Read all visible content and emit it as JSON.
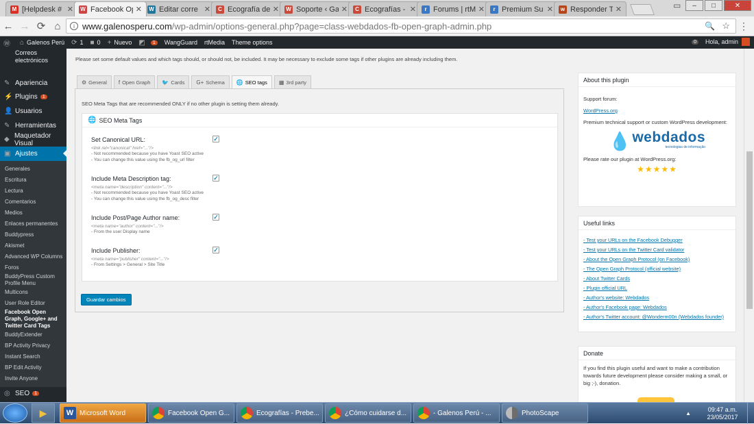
{
  "browser": {
    "tabs": [
      {
        "title": "[Helpdesk #",
        "color": "#d93025",
        "glyph": "M"
      },
      {
        "title": "Facebook Op",
        "color": "#cc4444",
        "glyph": "W",
        "active": true
      },
      {
        "title": "Editar corre",
        "color": "#21759b",
        "glyph": "W"
      },
      {
        "title": "Ecografía de",
        "color": "#c94a3a",
        "glyph": "C"
      },
      {
        "title": "Soporte ‹ Ga",
        "color": "#c94a3a",
        "glyph": "W"
      },
      {
        "title": "Ecografías -",
        "color": "#c94a3a",
        "glyph": "C"
      },
      {
        "title": "Forums | rtM",
        "color": "#3a78c4",
        "glyph": "r"
      },
      {
        "title": "Premium Su",
        "color": "#3a78c4",
        "glyph": "r"
      },
      {
        "title": "Responder T",
        "color": "#b5451b",
        "glyph": "w"
      }
    ],
    "url_host": "www.galenosperu.com",
    "url_path": "/wp-admin/options-general.php?page=class-webdados-fb-open-graph-admin.php"
  },
  "adminbar": {
    "site": "Galenos Perú",
    "updates": "1",
    "comments": "0",
    "new": "Nuevo",
    "plugin_count": "1",
    "wangguard": "WangGuard",
    "rtmedia": "rtMedia",
    "theme_options": "Theme options",
    "notif": "0",
    "greeting": "Hola, admin"
  },
  "sidebar": {
    "top_item": "Correos electrónicos",
    "items": [
      {
        "label": "Apariencia",
        "icon": "paintbrush-icon",
        "glyph": "✎"
      },
      {
        "label": "Plugins",
        "icon": "plug-icon",
        "glyph": "⚡",
        "badge": "1"
      },
      {
        "label": "Usuarios",
        "icon": "users-icon",
        "glyph": "👤"
      },
      {
        "label": "Herramientas",
        "icon": "wrench-icon",
        "glyph": "✎"
      },
      {
        "label": "Maquetador Visual",
        "icon": "builder-icon",
        "glyph": "◆"
      },
      {
        "label": "Ajustes",
        "icon": "settings-icon",
        "glyph": "▣",
        "current": true
      }
    ],
    "sub_items": [
      {
        "label": "Generales"
      },
      {
        "label": "Escritura"
      },
      {
        "label": "Lectura"
      },
      {
        "label": "Comentarios"
      },
      {
        "label": "Medios"
      },
      {
        "label": "Enlaces permanentes"
      },
      {
        "label": "Buddypress"
      },
      {
        "label": "Akismet"
      },
      {
        "label": "Advanced WP Columns"
      },
      {
        "label": "Foros"
      },
      {
        "label": "BuddyPress Custom Profile Menu"
      },
      {
        "label": "Multicons"
      },
      {
        "label": "User Role Editor"
      },
      {
        "label": "Facebook Open Graph, Google+ and Twitter Card Tags",
        "current": true
      },
      {
        "label": "BuddyExtender"
      },
      {
        "label": "BP Activity Privacy"
      },
      {
        "label": "Instant Search"
      },
      {
        "label": "BP Edit Activity"
      },
      {
        "label": "Invite Anyone"
      }
    ],
    "bottom_item": "SEO",
    "bottom_badge": "1"
  },
  "main": {
    "intro": "Please set some default values and which tags should, or should not, be included. It may be necessary to exclude some tags if other plugins are already including them.",
    "tabs": [
      {
        "label": "General",
        "glyph": "⚙"
      },
      {
        "label": "Open Graph",
        "glyph": "f"
      },
      {
        "label": "Cards",
        "glyph": "🐦"
      },
      {
        "label": "Schema",
        "glyph": "G+"
      },
      {
        "label": "SEO tags",
        "glyph": "🌐",
        "active": true
      },
      {
        "label": "3rd party",
        "glyph": "▦"
      }
    ],
    "lead": "SEO Meta Tags that are recommended ONLY if no other plugin is setting them already.",
    "panel_title": "SEO Meta Tags",
    "options": [
      {
        "label": "Set Canonical URL:",
        "code": "<link rel=\"canonical\" href=\"...\"/>",
        "notes": [
          "- Not recommended because you have Yoast SEO active",
          "- You can change this value using the fb_og_url filter"
        ],
        "checked": true
      },
      {
        "label": "Include Meta Description tag:",
        "code": "<meta name=\"description\" content=\"...\"/>",
        "notes": [
          "- Not recommended because you have Yoast SEO active",
          "- You can change this value using the fb_og_desc filter"
        ],
        "checked": true
      },
      {
        "label": "Include Post/Page Author name:",
        "code": "<meta name=\"author\" content=\"...\"/>",
        "notes": [
          "- From the user Display name"
        ],
        "checked": true
      },
      {
        "label": "Include Publisher:",
        "code": "<meta name=\"publisher\" content=\"...\"/>",
        "notes": [
          "- From Settings > General > Site Title"
        ],
        "checked": true
      }
    ],
    "save_label": "Guardar cambios"
  },
  "about": {
    "title": "About this plugin",
    "support_label": "Support forum:",
    "support_link": "WordPress.org",
    "premium_text": "Premium technical support or custom WordPress development:",
    "logo_word": "webdados",
    "logo_sub": "tecnologias de informação",
    "rate_text": "Please rate our plugin at WordPress.org:",
    "stars": "★★★★★"
  },
  "useful": {
    "title": "Useful links",
    "links": [
      "- Test your URLs on the Facebook Debugger",
      "- Test your URLs on the Twitter Card validator",
      "- About the Open Graph Protocol (on Facebook)",
      "- The Open Graph Protocol (official website)",
      "- About Twitter Cards",
      "- Plugin official URL",
      "- Author's website: Webdados",
      "- Author's Facebook page: Webdados",
      "- Author's Twitter account: @Wonderm00n (Webdados founder)"
    ]
  },
  "donate": {
    "title": "Donate",
    "text": "If you find this plugin useful and want to make a contribution towards future development please consider making a small, or big ;-), donation."
  },
  "taskbar": {
    "buttons": [
      {
        "label": "Microsoft Word",
        "kind": "word",
        "active": true
      },
      {
        "label": "Facebook Open G...",
        "kind": "chrome"
      },
      {
        "label": "Ecografías - Prebe...",
        "kind": "chrome"
      },
      {
        "label": "¿Cómo cuidarse d...",
        "kind": "chrome"
      },
      {
        "label": "- Galenos Perú - ...",
        "kind": "chrome"
      },
      {
        "label": "PhotoScape",
        "kind": "ps"
      }
    ],
    "time": "09:47 a.m.",
    "date": "23/05/2017"
  }
}
